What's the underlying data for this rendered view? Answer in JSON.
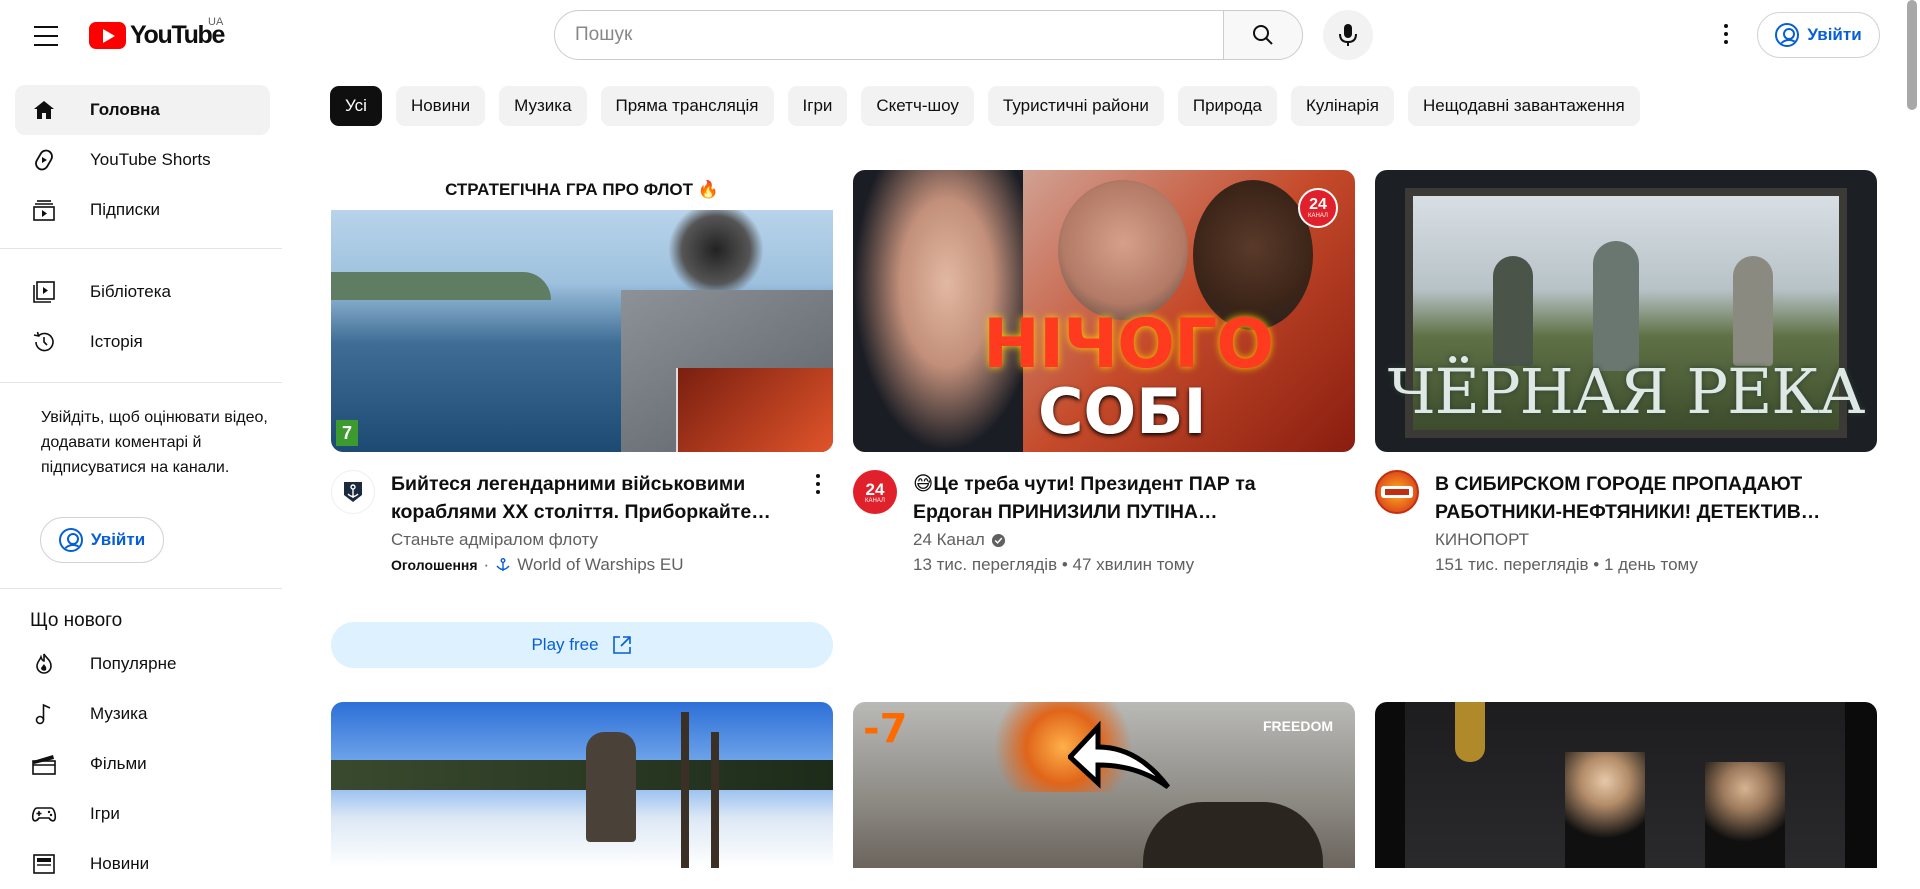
{
  "header": {
    "logo_text": "YouTube",
    "region": "UA",
    "search_placeholder": "Пошук",
    "signin_label": "Увійти"
  },
  "sidebar": {
    "main": [
      {
        "label": "Головна",
        "icon": "home-icon"
      },
      {
        "label": "YouTube Shorts",
        "icon": "shorts-icon"
      },
      {
        "label": "Підписки",
        "icon": "subscriptions-icon"
      }
    ],
    "library": [
      {
        "label": "Бібліотека",
        "icon": "library-icon"
      },
      {
        "label": "Історія",
        "icon": "history-icon"
      }
    ],
    "signin_note": "Увійдіть, щоб оцінювати відео, додавати коментарі й підписуватися на канали.",
    "signin_label": "Увійти",
    "section_title": "Що нового",
    "explore": [
      {
        "label": "Популярне",
        "icon": "trending-icon"
      },
      {
        "label": "Музика",
        "icon": "music-icon"
      },
      {
        "label": "Фільми",
        "icon": "movies-icon"
      },
      {
        "label": "Ігри",
        "icon": "gaming-icon"
      },
      {
        "label": "Новини",
        "icon": "news-icon"
      }
    ]
  },
  "chips": [
    "Усі",
    "Новини",
    "Музика",
    "Пряма трансляція",
    "Ігри",
    "Скетч-шоу",
    "Туристичні райони",
    "Природа",
    "Кулінарія",
    "Нещодавні завантаження"
  ],
  "videos": [
    {
      "thumb_caption": "СТРАТЕГІЧНА ГРА ПРО ФЛОТ 🔥",
      "thumb_badge": "7",
      "title": "Бийтеся легендарними військовими кораблями ХХ століття. Приборкайте…",
      "line1": "Станьте адміралом флоту",
      "ad_label": "Оголошення",
      "dot": "·",
      "advertiser": "World of Warships EU",
      "cta": "Play free"
    },
    {
      "thumb_line1": "НІЧОГО",
      "thumb_line2": "СОБІ",
      "thumb_badge": "24",
      "thumb_badge_sub": "КАНАЛ",
      "title": "😅Це треба чути! Президент ПАР та Ердоган ПРИНИЗИЛИ ПУТІНА…",
      "channel": "24 Канал",
      "stats": "13 тис. переглядів • 47 хвилин тому"
    },
    {
      "thumb_caption": "ЧЁРНАЯ РЕКА",
      "title": "В СИБИРСКОМ ГОРОДЕ ПРОПАДАЮТ РАБОТНИКИ-НЕФТЯНИКИ! ДЕТЕКТИВ…",
      "channel": "КИНОПОРТ",
      "stats": "151 тис. переглядів • 1 день тому"
    }
  ],
  "row2": [
    {
      "thumb_text": ""
    },
    {
      "thumb_text": "-7",
      "badge": "FREEDOM"
    },
    {
      "thumb_text": ""
    }
  ],
  "colors": {
    "brand_red": "#ff0000",
    "link_blue": "#065fd4",
    "chip_bg": "#f2f2f2",
    "chip_active": "#0f0f0f"
  }
}
